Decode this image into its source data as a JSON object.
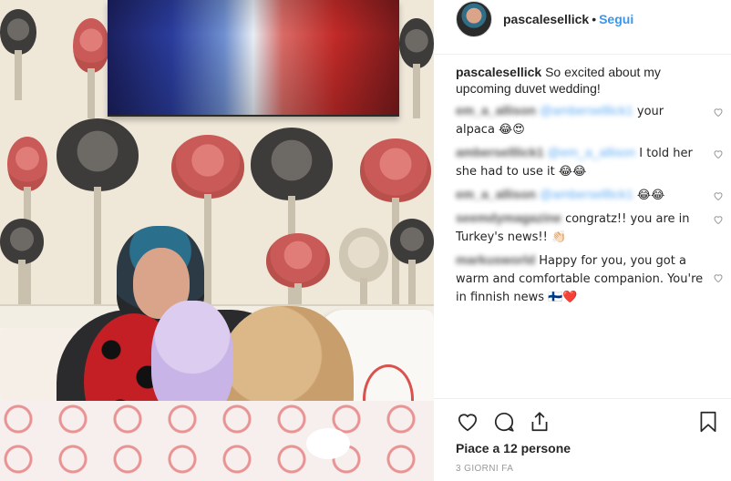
{
  "post": {
    "username": "pascalesellick",
    "separator": "•",
    "follow_label": "Segui",
    "caption": "So excited about my upcoming duvet wedding!"
  },
  "comments": [
    {
      "user": "em_a_allison",
      "mention": "@amberselllick1",
      "text": " your alpaca 😂😍"
    },
    {
      "user": "amberselllick1",
      "mention": "@em_a_allison",
      "text": " I told her she had to use it 😂😂"
    },
    {
      "user": "em_a_allison",
      "mention": "@amberselllick1",
      "text": " 😂😂"
    },
    {
      "user": "seemdymagazine",
      "mention": "",
      "text": " congratz!! you are in Turkey's news!! 👏🏻"
    },
    {
      "user": "markusworld",
      "mention": "",
      "text": " Happy for you, you got a warm and comfortable companion. You're in finnish news 🇫🇮❤️"
    }
  ],
  "actions": {
    "like_icon": "heart-outline-icon",
    "comment_icon": "comment-bubble-icon",
    "share_icon": "share-icon",
    "save_icon": "bookmark-icon"
  },
  "likes_text": "Piace a 12 persone",
  "timestamp": "3 GIORNI FA",
  "colors": {
    "link": "#3897f0",
    "text": "#262626",
    "muted": "#999999",
    "border": "#efefef"
  }
}
